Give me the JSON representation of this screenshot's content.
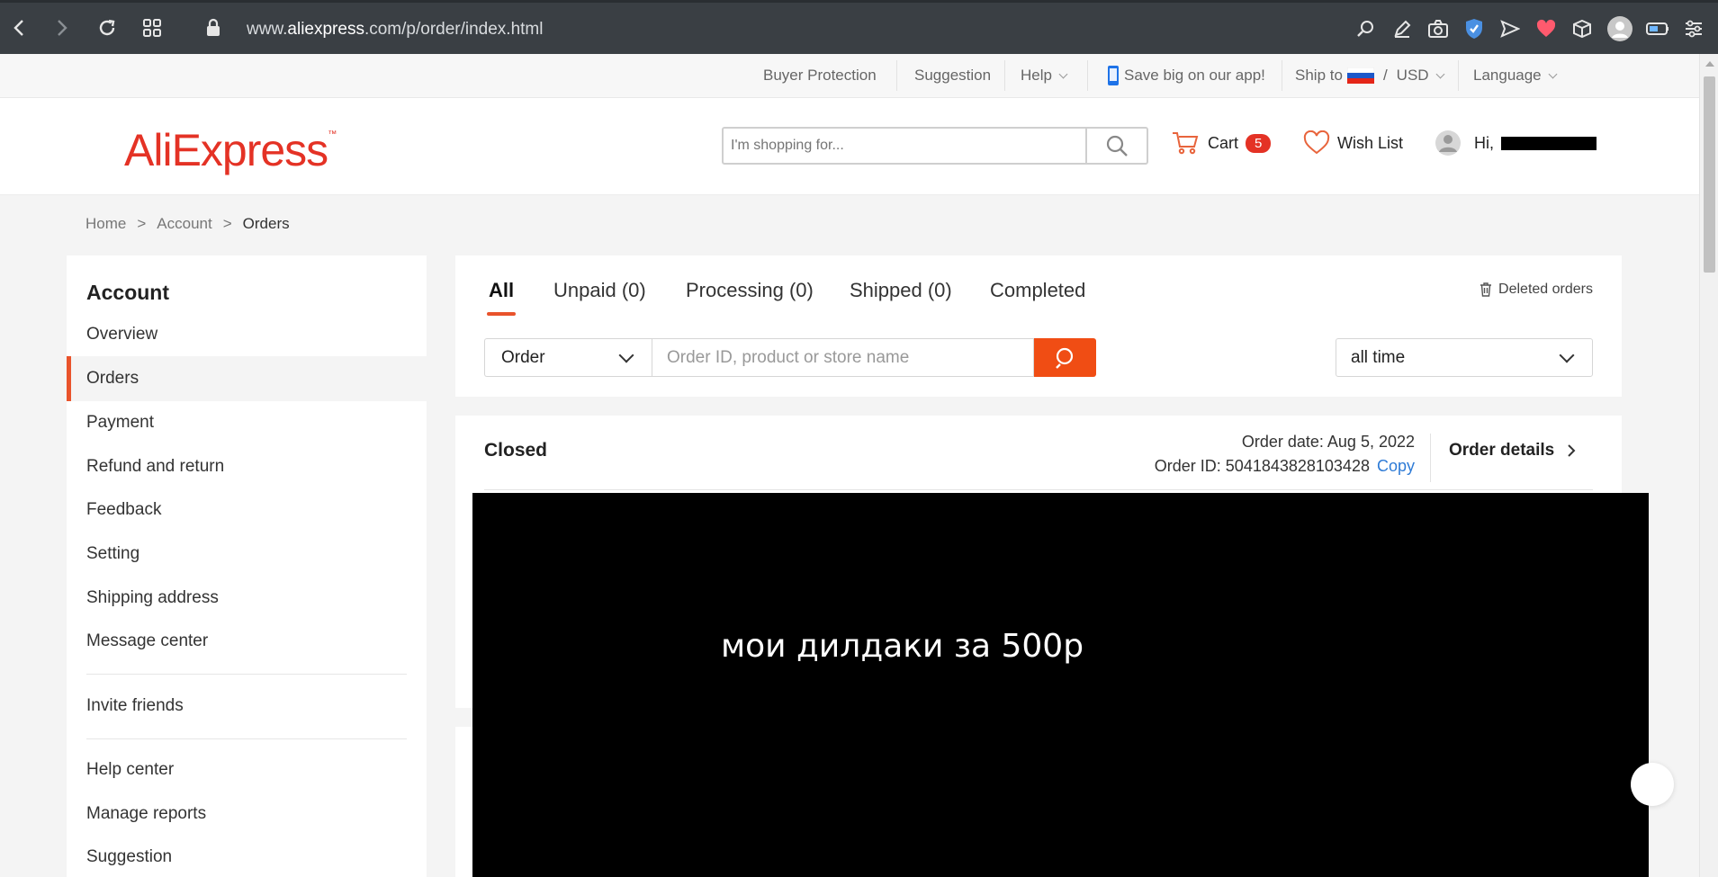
{
  "browser": {
    "url_prefix": "www.",
    "url_domain": "aliexpress",
    "url_suffix": ".com/p/order/index.html"
  },
  "topbar": {
    "buyer_protection": "Buyer Protection",
    "suggestion": "Suggestion",
    "help": "Help",
    "app_promo": "Save big on our app!",
    "ship_to": "Ship to",
    "slash": "/",
    "currency": "USD",
    "language": "Language"
  },
  "header": {
    "logo": "AliExpress",
    "logo_tm": "™",
    "search_placeholder": "I'm shopping for...",
    "cart_label": "Cart",
    "cart_count": "5",
    "wishlist_label": "Wish List",
    "greeting": "Hi,"
  },
  "breadcrumb": {
    "home": "Home",
    "account": "Account",
    "orders": "Orders",
    "separator": ">"
  },
  "sidebar": {
    "title": "Account",
    "items": [
      "Overview",
      "Orders",
      "Payment",
      "Refund and return",
      "Feedback",
      "Setting",
      "Shipping address",
      "Message center"
    ],
    "invite": "Invite friends",
    "help_items": [
      "Help center",
      "Manage reports",
      "Suggestion"
    ],
    "active_index": 1
  },
  "orders": {
    "tabs": [
      "All",
      "Unpaid (0)",
      "Processing (0)",
      "Shipped (0)",
      "Completed"
    ],
    "active_tab": 0,
    "deleted_orders": "Deleted orders",
    "filter_type": "Order",
    "filter_placeholder": "Order ID, product or store name",
    "time_range": "all time"
  },
  "order_card": {
    "status": "Closed",
    "order_date": "Order date: Aug 5, 2022",
    "order_id": "Order ID: 5041843828103428",
    "copy": "Copy",
    "details": "Order details"
  },
  "overlay": {
    "text": "мои дилдаки за 500р"
  },
  "colors": {
    "accent": "#e9532b",
    "brand": "#e43225",
    "search_button": "#f04d14",
    "link": "#2e7bd6",
    "browser_bar": "#3a3f44"
  },
  "icons": {
    "back": "arrow-left-icon",
    "forward": "arrow-right-icon",
    "reload": "reload-icon",
    "apps": "grid-icon",
    "lock": "lock-icon",
    "search": "search-icon",
    "cart": "cart-icon",
    "wishlist": "heart-icon",
    "trash": "trash-icon",
    "phone": "phone-icon",
    "flag": "russia-flag-icon"
  }
}
